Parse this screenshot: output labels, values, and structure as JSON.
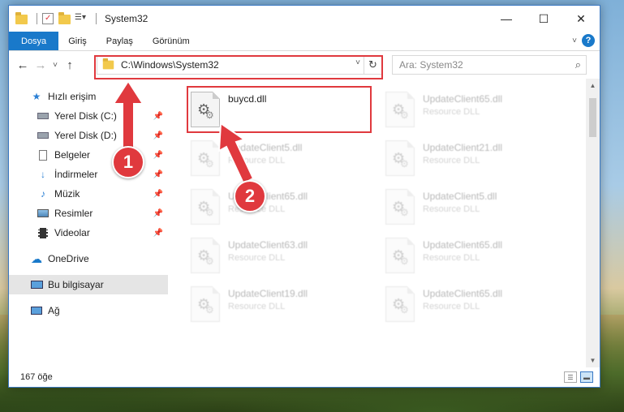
{
  "window": {
    "title": "System32",
    "controls": {
      "minimize": "—",
      "maximize": "☐",
      "close": "✕"
    }
  },
  "ribbon": {
    "tabs": [
      {
        "label": "Dosya",
        "active": true
      },
      {
        "label": "Giriş"
      },
      {
        "label": "Paylaş"
      },
      {
        "label": "Görünüm"
      }
    ],
    "expand_icon": "chevron-down-icon",
    "help_label": "?"
  },
  "nav": {
    "back": "←",
    "forward": "→",
    "recent": "˅",
    "up": "↑",
    "address": "C:\\Windows\\System32",
    "refresh": "↻",
    "search_placeholder": "Ara: System32",
    "search_icon": "⌕"
  },
  "sidebar": {
    "quick_access": "Hızlı erişim",
    "pinned": [
      {
        "label": "Yerel Disk (C:)",
        "icon": "drive-icon"
      },
      {
        "label": "Yerel Disk (D:)",
        "icon": "drive-icon"
      },
      {
        "label": "Belgeler",
        "icon": "documents-icon"
      },
      {
        "label": "İndirmeler",
        "icon": "downloads-icon"
      },
      {
        "label": "Müzik",
        "icon": "music-icon"
      },
      {
        "label": "Resimler",
        "icon": "pictures-icon"
      },
      {
        "label": "Videolar",
        "icon": "videos-icon"
      }
    ],
    "onedrive": "OneDrive",
    "this_pc": "Bu bilgisayar",
    "network": "Ağ"
  },
  "files": [
    {
      "name": "buycd.dll",
      "type": ""
    },
    {
      "name": "UpdateClient65.dll",
      "type": "Resource DLL"
    },
    {
      "name": "UpdateClient5.dll",
      "type": "Resource DLL"
    },
    {
      "name": "UpdateClient21.dll",
      "type": "Resource DLL"
    },
    {
      "name": "UpdateClient65.dll",
      "type": "Resource DLL"
    },
    {
      "name": "UpdateClient5.dll",
      "type": "Resource DLL"
    },
    {
      "name": "UpdateClient63.dll",
      "type": "Resource DLL"
    },
    {
      "name": "UpdateClient65.dll",
      "type": "Resource DLL"
    },
    {
      "name": "UpdateClient19.dll",
      "type": "Resource DLL"
    },
    {
      "name": "UpdateClient65.dll",
      "type": "Resource DLL"
    }
  ],
  "status": {
    "count": "167 öğe"
  },
  "callouts": [
    {
      "label": "1"
    },
    {
      "label": "2"
    }
  ],
  "colors": {
    "accent": "#1979ca",
    "highlight": "#e0393e",
    "selected": "#cce4f7"
  }
}
